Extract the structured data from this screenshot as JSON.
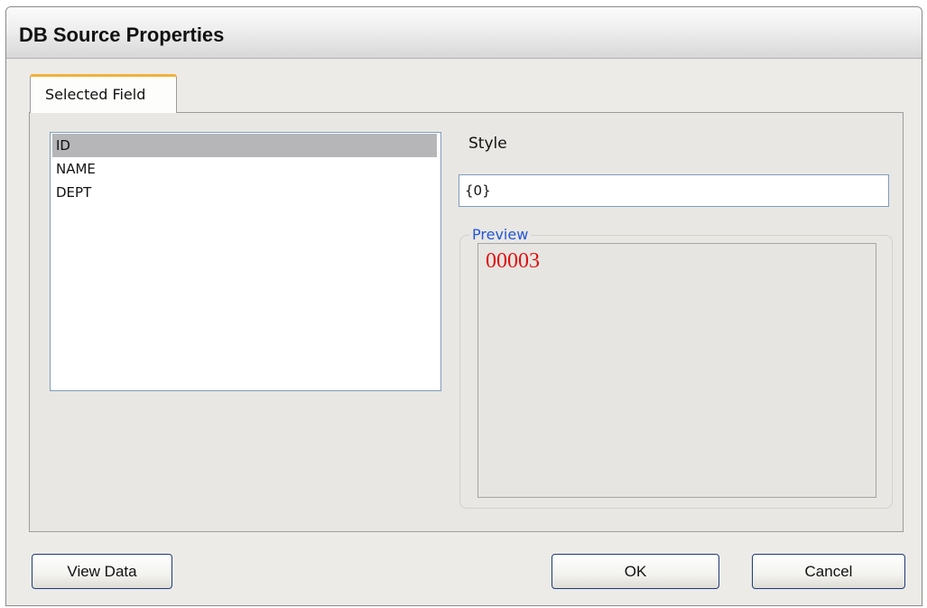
{
  "window": {
    "title": "DB Source Properties"
  },
  "tabs": [
    {
      "label": "Selected Field",
      "active": true
    }
  ],
  "fields": {
    "items": [
      "ID",
      "NAME",
      "DEPT"
    ],
    "selected": "ID"
  },
  "style": {
    "label": "Style",
    "value": "{0}"
  },
  "preview": {
    "legend": "Preview",
    "value": "00003"
  },
  "buttons": {
    "view_data": "View Data",
    "ok": "OK",
    "cancel": "Cancel"
  },
  "colors": {
    "preview_legend": "#2456d6",
    "preview_value": "#e01010",
    "tab_accent": "#f2b13c"
  }
}
